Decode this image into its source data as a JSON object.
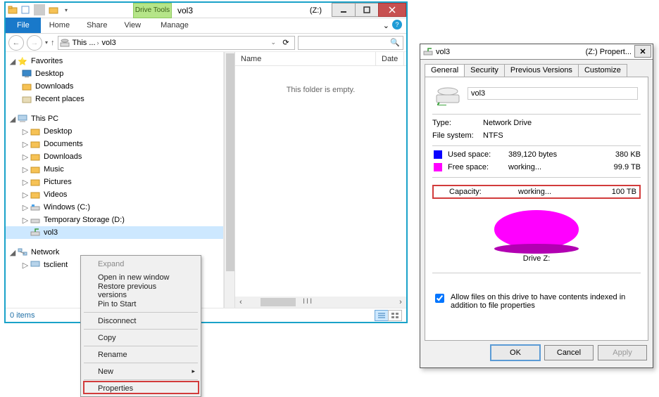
{
  "explorer": {
    "drive_tools_tab": "Drive Tools",
    "title_volume": "vol3",
    "title_drive": "(Z:)",
    "ribbon": {
      "file": "File",
      "home": "Home",
      "share": "Share",
      "view": "View",
      "manage": "Manage"
    },
    "breadcrumb": {
      "this_trunc": "This ...",
      "last": "vol3"
    },
    "search_placeholder": "",
    "tree": {
      "favorites": {
        "label": "Favorites",
        "items": [
          "Desktop",
          "Downloads",
          "Recent places"
        ]
      },
      "this_pc": {
        "label": "This PC",
        "items": [
          "Desktop",
          "Documents",
          "Downloads",
          "Music",
          "Pictures",
          "Videos",
          "Windows (C:)",
          "Temporary Storage (D:)",
          "vol3 (Z:)"
        ],
        "selected_display": "vol3"
      },
      "network": {
        "label": "Network",
        "items": [
          "tsclient"
        ]
      }
    },
    "columns": {
      "name": "Name",
      "date": "Date"
    },
    "empty_message": "This folder is empty.",
    "scroll_marker": "III",
    "status_items": "0 items"
  },
  "context_menu": {
    "expand": "Expand",
    "open_new": "Open in new window",
    "restore": "Restore previous versions",
    "pin": "Pin to Start",
    "disconnect": "Disconnect",
    "copy": "Copy",
    "rename": "Rename",
    "new": "New",
    "properties": "Properties"
  },
  "properties": {
    "title_vol": "vol3",
    "title_right": "(Z:) Propert...",
    "tabs": {
      "general": "General",
      "security": "Security",
      "previous": "Previous Versions",
      "customize": "Customize"
    },
    "volume_name": "vol3",
    "type_label": "Type:",
    "type_value": "Network Drive",
    "fs_label": "File system:",
    "fs_value": "NTFS",
    "used_label": "Used space:",
    "used_bytes": "389,120 bytes",
    "used_hr": "380 KB",
    "free_label": "Free space:",
    "free_bytes": "working...",
    "free_hr": "99.9 TB",
    "capacity_label": "Capacity:",
    "capacity_bytes": "working...",
    "capacity_hr": "100 TB",
    "drive_caption": "Drive Z:",
    "index_checkbox": "Allow files on this drive to have contents indexed in addition to file properties",
    "buttons": {
      "ok": "OK",
      "cancel": "Cancel",
      "apply": "Apply"
    }
  }
}
